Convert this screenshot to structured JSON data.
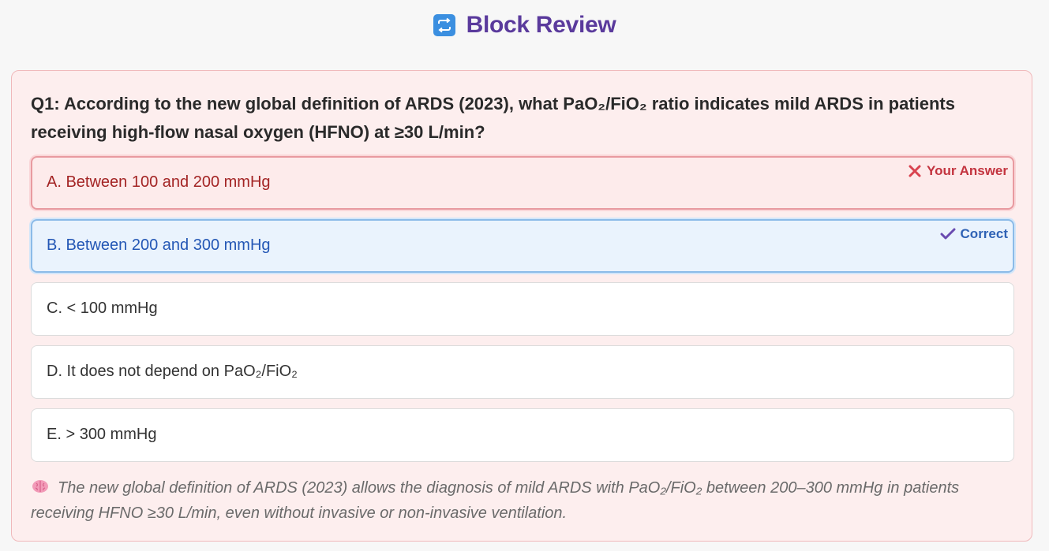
{
  "header": {
    "icon": "repeat-arrows-icon",
    "title": "Block Review"
  },
  "question": {
    "text": "Q1: According to the new global definition of ARDS (2023), what PaO₂/FiO₂ ratio indicates mild ARDS in patients receiving high-flow nasal oxygen (HFNO) at ≥30 L/min?"
  },
  "options": [
    {
      "label": "A. Between 100 and 200 mmHg",
      "state": "your-answer",
      "tag": "Your Answer",
      "tag_icon": "x-icon"
    },
    {
      "label": "B. Between 200 and 300 mmHg",
      "state": "correct",
      "tag": "Correct",
      "tag_icon": "check-icon"
    },
    {
      "label": "C. < 100 mmHg",
      "state": "neutral"
    },
    {
      "label": "D. It does not depend on PaO₂/FiO₂",
      "state": "neutral"
    },
    {
      "label": "E. > 300 mmHg",
      "state": "neutral"
    }
  ],
  "explanation": {
    "icon": "brain-icon",
    "text": "The new global definition of ARDS (2023) allows the diagnosis of mild ARDS with PaO₂/FiO₂ between 200–300 mmHg in patients receiving HFNO ≥30 L/min, even without invasive or non-invasive ventilation."
  },
  "colors": {
    "title": "#5a3a9c",
    "card_bg": "#fdeeee",
    "wrong": "#c3343f",
    "correct": "#2f62b5"
  }
}
